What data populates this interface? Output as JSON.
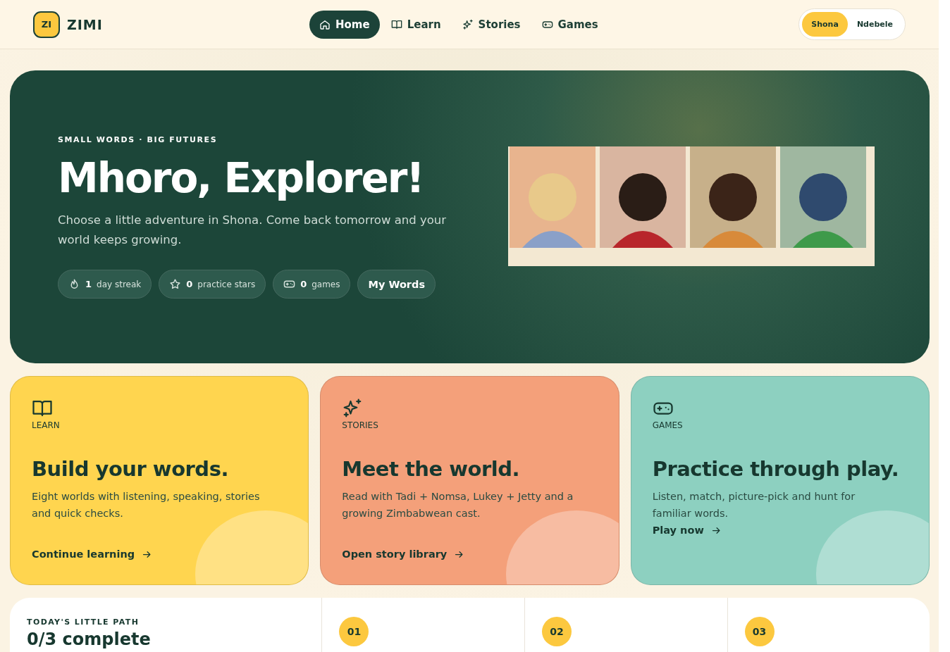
{
  "brand": {
    "badge": "ZI",
    "name": "ZIMI"
  },
  "nav": [
    {
      "label": "Home",
      "kind": "home",
      "selected": true
    },
    {
      "label": "Learn",
      "kind": "learn",
      "selected": false
    },
    {
      "label": "Stories",
      "kind": "stories",
      "selected": false
    },
    {
      "label": "Games",
      "kind": "games",
      "selected": false
    }
  ],
  "languages": [
    {
      "label": "Shona",
      "selected": true
    },
    {
      "label": "Ndebele",
      "selected": false
    }
  ],
  "hero": {
    "eyebrow": "SMALL WORDS · BIG FUTURES",
    "title": "Mhoro, Explorer!",
    "text": "Choose a little adventure in Shona. Come back tomorrow and your world keeps growing.",
    "stats": [
      {
        "kind": "streak",
        "value": "1",
        "label": "day streak"
      },
      {
        "kind": "stars",
        "value": "0",
        "label": "practice stars"
      },
      {
        "kind": "games",
        "value": "0",
        "label": "games"
      }
    ],
    "button": "My Words"
  },
  "cards": [
    {
      "kind": "learn",
      "tag": "LEARN",
      "title": "Build your words.",
      "text": "Eight worlds with listening, speaking, stories and quick checks.",
      "link": "Continue learning",
      "color": "#ffd54f"
    },
    {
      "kind": "stories",
      "tag": "STORIES",
      "title": "Meet the world.",
      "text": "Read with Tadi + Nomsa, Lukey + Jetty and a growing Zimbabwean cast.",
      "link": "Open story library",
      "color": "#f4a07a"
    },
    {
      "kind": "games",
      "tag": "GAMES",
      "title": "Practice through play.",
      "text": "Listen, match, picture-pick and hunt for familiar words.",
      "link": "Play now",
      "color": "#8dd0c0"
    }
  ],
  "path": {
    "eyebrow": "TODAY'S LITTLE PATH",
    "title": "0/3 complete",
    "steps": [
      "01",
      "02",
      "03"
    ]
  }
}
